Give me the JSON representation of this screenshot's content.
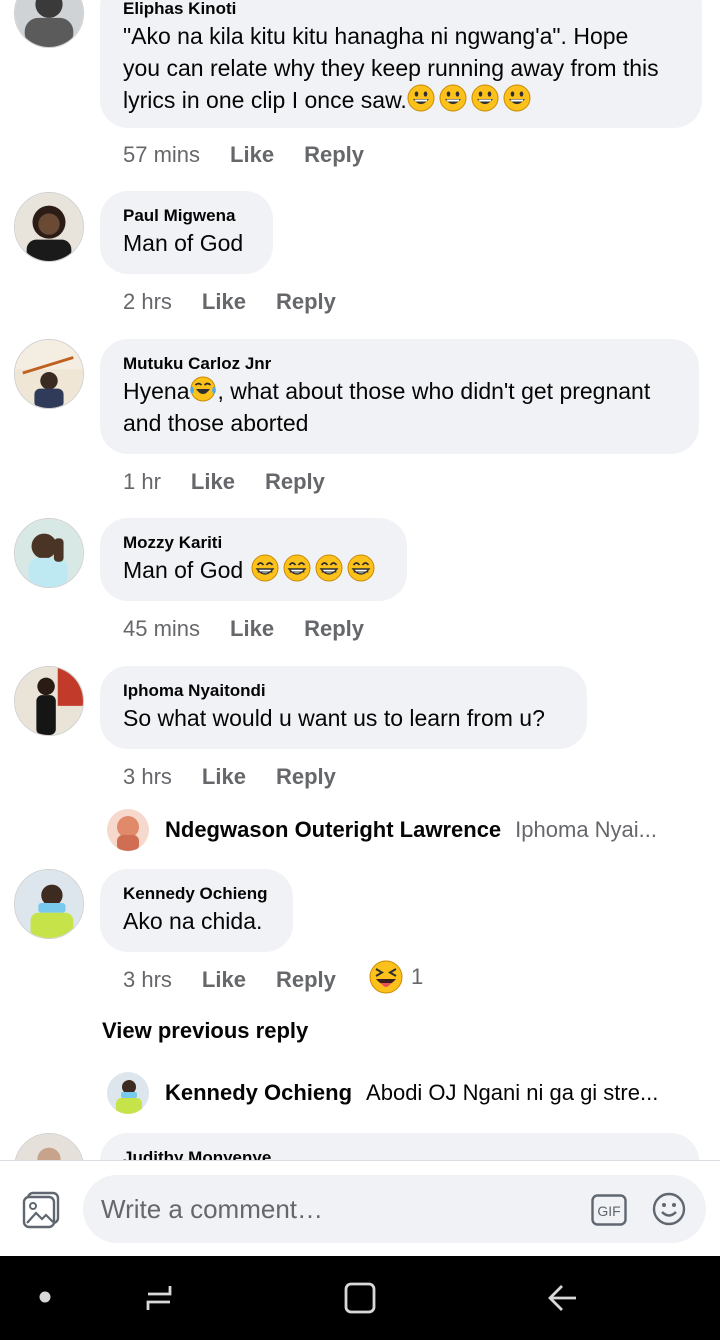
{
  "comments": [
    {
      "author": "Eliphas Kinoti",
      "lines": [
        "\"Ako na kila kitu kitu hanagha ni ngwang'a\". Hope",
        "you can relate why they keep running away from this",
        "lyrics in one clip I once saw."
      ],
      "time": "57 mins"
    },
    {
      "author": "Paul Migwena",
      "lines": [
        "Man of God"
      ],
      "time": "2 hrs"
    },
    {
      "author": "Mutuku Carloz Jnr",
      "lines": [
        "Hyena",
        ", what about those who didn't get pregnant",
        "and those aborted"
      ],
      "time": "1 hr"
    },
    {
      "author": "Mozzy Kariti",
      "lines": [
        "Man of God"
      ],
      "time": "45 mins"
    },
    {
      "author": "Iphoma Nyaitondi",
      "lines": [
        "So what would u want us to learn from u?"
      ],
      "time": "3 hrs"
    },
    {
      "author": "Kennedy Ochieng",
      "lines": [
        "Ako na chida."
      ],
      "time": "3 hrs",
      "reaction_count": "1"
    },
    {
      "author": "Judithy Monyenye"
    }
  ],
  "actions": {
    "like": "Like",
    "reply": "Reply"
  },
  "replies": [
    {
      "author": "Ndegwason Outeright Lawrence",
      "preview": "Iphoma Nyai..."
    },
    {
      "author": "Kennedy Ochieng",
      "preview": "Abodi OJ Ngani ni ga gi stre..."
    }
  ],
  "view_previous_reply": "View previous reply",
  "composer": {
    "placeholder": "Write a comment…",
    "gif_label": "GIF"
  },
  "icons": {
    "grin": "grinning-face-emoji",
    "beam": "beaming-face-emoji",
    "tears": "face-with-tears-of-joy-emoji",
    "squint": "squinting-face-with-tongue-emoji"
  },
  "colors": {
    "bubble": "#f0f2f5",
    "secondary_text": "#65676b",
    "emoji_yellow": "#fcc21b",
    "navbar": "#000000"
  }
}
